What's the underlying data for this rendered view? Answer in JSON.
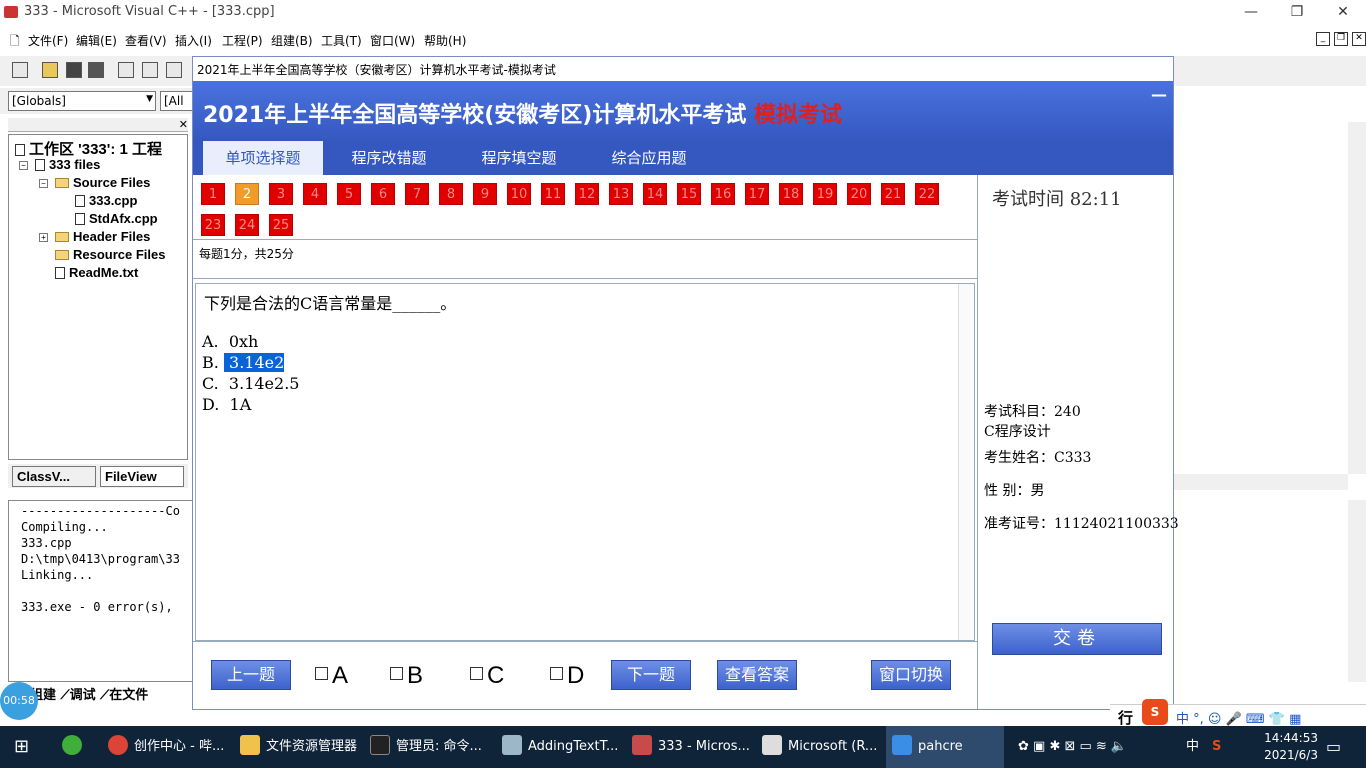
{
  "vc": {
    "title": "333 - Microsoft Visual C++ - [333.cpp]",
    "menu": [
      "文件(F)",
      "编辑(E)",
      "查看(V)",
      "插入(I)",
      "工程(P)",
      "组建(B)",
      "工具(T)",
      "窗口(W)",
      "帮助(H)"
    ],
    "globals": "[Globals]",
    "all_combo": "[All g",
    "workspace": {
      "root": "工作区 '333': 1 工程",
      "project": "333 files",
      "source_files": "Source Files",
      "file1": "333.cpp",
      "file2": "StdAfx.cpp",
      "header_files": "Header Files",
      "resource_files": "Resource Files",
      "readme": "ReadMe.txt",
      "tab_class": "ClassV...",
      "tab_file": "FileView"
    },
    "output": "--------------------Co\nCompiling...\n333.cpp\nD:\\tmp\\0413\\program\\33\nLinking...\n\n333.exe - 0 error(s),",
    "output_tabs": "组建 ⟋调试 ⟋在文件",
    "timer_badge": "00:58"
  },
  "exam": {
    "window_title": "2021年上半年全国高等学校（安徽考区）计算机水平考试-模拟考试",
    "banner_title": "2021年上半年全国高等学校(安徽考区)计算机水平考试",
    "banner_mode": "模拟考试",
    "minimize": "—",
    "tabs": [
      "单项选择题",
      "程序改错题",
      "程序填空题",
      "综合应用题"
    ],
    "numbers": [
      "1",
      "2",
      "3",
      "4",
      "5",
      "6",
      "7",
      "8",
      "9",
      "10",
      "11",
      "12",
      "13",
      "14",
      "15",
      "16",
      "17",
      "18",
      "19",
      "20",
      "21",
      "22",
      "23",
      "24",
      "25"
    ],
    "current_number": "2",
    "score_note": "每题1分，共25分",
    "question": "下列是合法的C语言常量是______。",
    "options": {
      "a": "A.  0xh",
      "b_prefix": "B. ",
      "b_sel": " 3.14e2",
      "c": "C.  3.14e2.5",
      "d": "D.  1A"
    },
    "timer": "考试时间 82:11",
    "subject_line1": "考试科目：240",
    "subject_line2": "C程序设计",
    "name": "考生姓名：C333",
    "gender": "性    别：男",
    "ticket": "准考证号：11124021100333",
    "submit": "交卷",
    "prev": "上一题",
    "next": "下一题",
    "answer": "查看答案",
    "switch": "窗口切换",
    "choices": [
      "A",
      "B",
      "C",
      "D"
    ]
  },
  "taskbar": {
    "items": [
      "创作中心 - 哔...",
      "文件资源管理器",
      "管理员: 命令...",
      "AddingTextT...",
      "333 - Micros...",
      "Microsoft (R...",
      "pahcre"
    ],
    "ime": "中",
    "time": "14:44:53",
    "date": "2021/6/3",
    "row_label": "行"
  }
}
